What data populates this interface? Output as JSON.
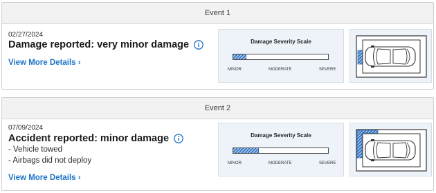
{
  "events": [
    {
      "header": "Event 1",
      "date": "02/27/2024",
      "title": "Damage reported: very minor damage",
      "bullets": [],
      "link": "View More Details ›",
      "scale": {
        "title": "Damage Severity Scale",
        "labels": [
          "MINOR",
          "MODERATE",
          "SEVERE"
        ],
        "level": 0.13
      },
      "damage_area": "front-left"
    },
    {
      "header": "Event 2",
      "date": "07/09/2024",
      "title": "Accident reported: minor damage",
      "bullets": [
        "- Vehicle towed",
        "- Airbags did not deploy"
      ],
      "link": "View More Details ›",
      "scale": {
        "title": "Damage Severity Scale",
        "labels": [
          "MINOR",
          "MODERATE",
          "SEVERE"
        ],
        "level": 0.26
      },
      "damage_area": "front-left-corner"
    }
  ],
  "icons": {
    "info": "info-icon",
    "car": "car-top-view-icon"
  },
  "colors": {
    "link": "#1b73c7",
    "damage_fill": "#2e6cb5",
    "card_bg": "#eef3f9"
  }
}
